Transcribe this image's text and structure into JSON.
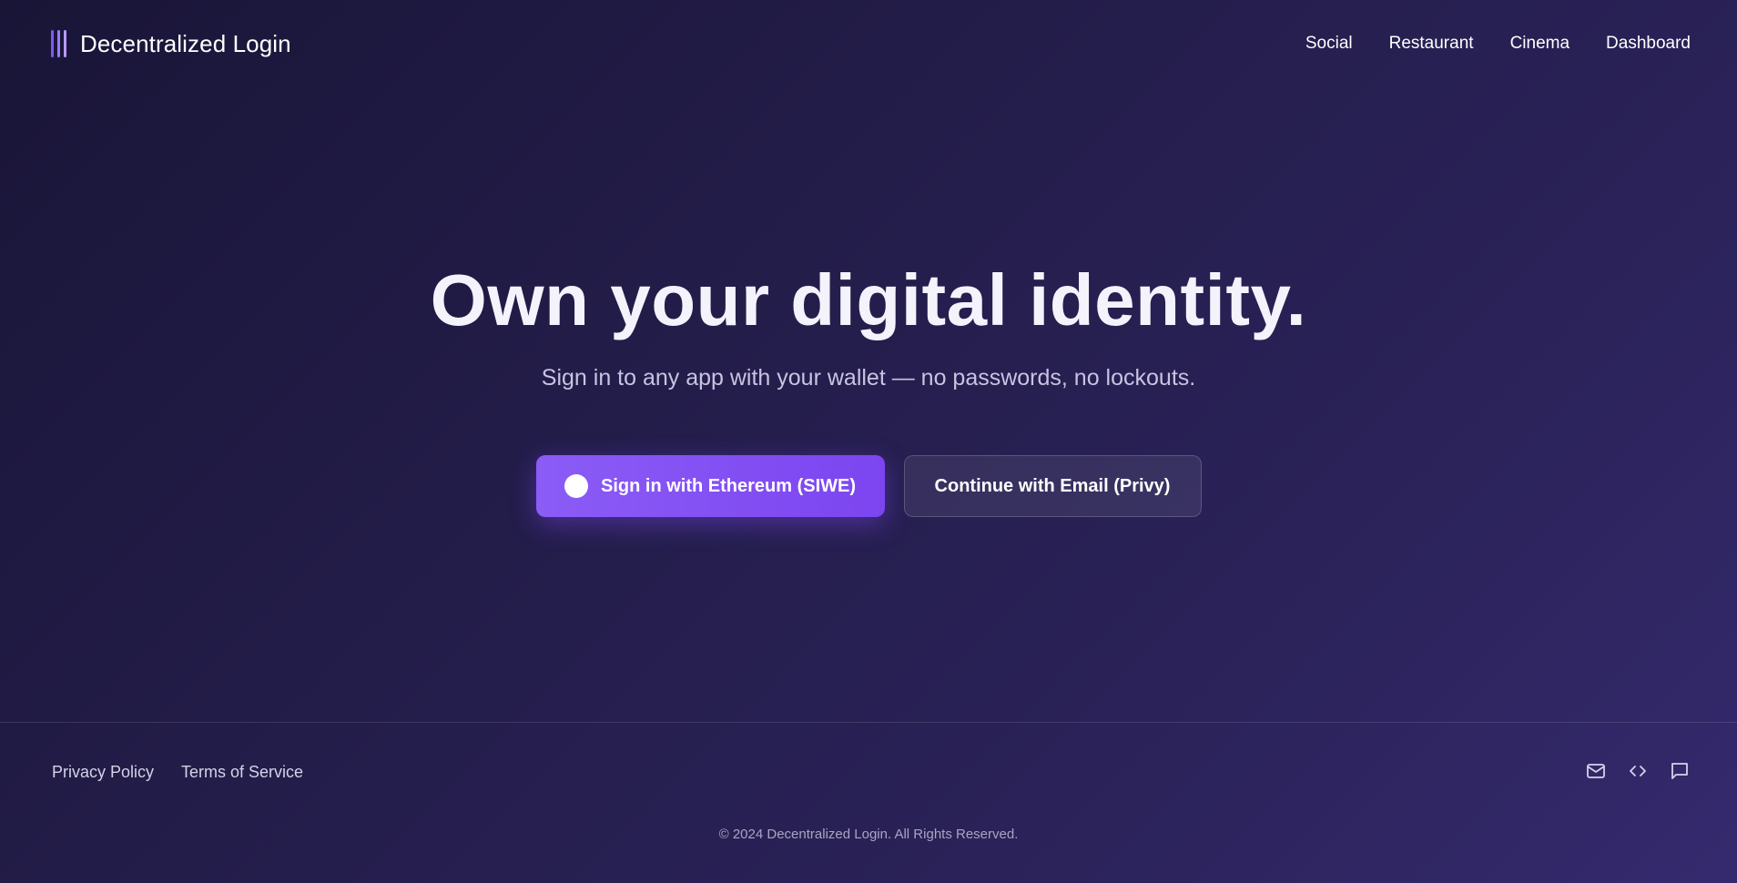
{
  "header": {
    "brand_name": "Decentralized Login",
    "nav": [
      {
        "label": "Social"
      },
      {
        "label": "Restaurant"
      },
      {
        "label": "Cinema"
      },
      {
        "label": "Dashboard"
      }
    ]
  },
  "hero": {
    "title": "Own your digital identity.",
    "subtitle": "Sign in to any app with your wallet — no passwords, no lockouts.",
    "primary_button": "Sign in with Ethereum (SIWE)",
    "secondary_button": "Continue with Email (Privy)"
  },
  "footer": {
    "links": [
      {
        "label": "Privacy Policy"
      },
      {
        "label": "Terms of Service"
      }
    ],
    "icons": [
      "mail-icon",
      "code-icon",
      "chat-icon"
    ],
    "copyright": "© 2024 Decentralized Login. All Rights Reserved."
  },
  "colors": {
    "accent": "#8b5cf6",
    "background_start": "#191537",
    "background_end": "#352a6e"
  }
}
